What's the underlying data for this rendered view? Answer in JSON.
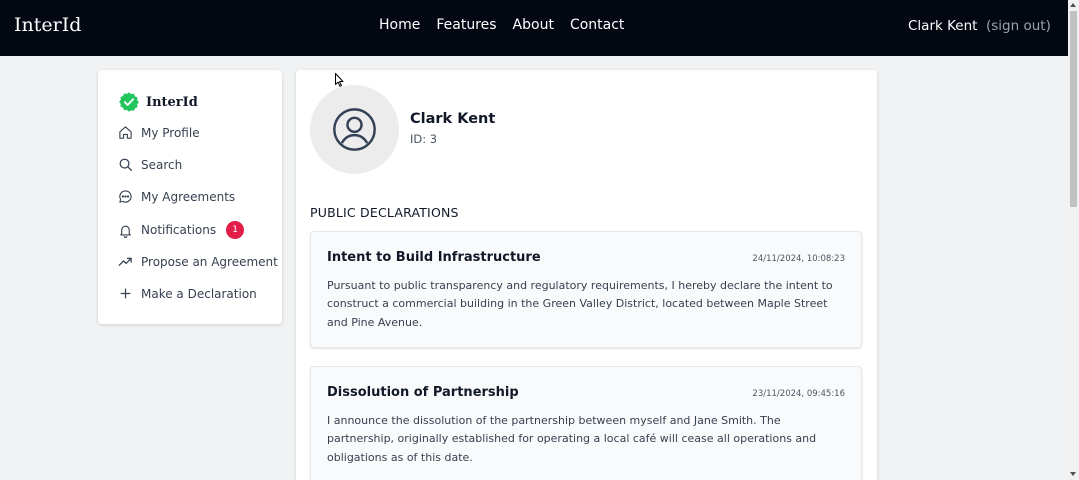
{
  "header": {
    "brand": "InterId",
    "nav": [
      "Home",
      "Features",
      "About",
      "Contact"
    ],
    "user_name": "Clark Kent",
    "sign_out": "(sign out)"
  },
  "sidebar": {
    "brand": "InterId",
    "items": [
      {
        "label": "My Profile",
        "icon": "home-icon"
      },
      {
        "label": "Search",
        "icon": "search-icon"
      },
      {
        "label": "My Agreements",
        "icon": "chat-icon"
      },
      {
        "label": "Notifications",
        "icon": "bell-icon",
        "badge": "1"
      },
      {
        "label": "Propose an Agreement",
        "icon": "trending-up-icon"
      },
      {
        "label": "Make a Declaration",
        "icon": "plus-icon"
      }
    ]
  },
  "profile": {
    "name": "Clark Kent",
    "id_text": "ID: 3"
  },
  "declarations": {
    "section_title": "PUBLIC DECLARATIONS",
    "items": [
      {
        "title": "Intent to Build Infrastructure",
        "date": "24/11/2024, 10:08:23",
        "body": "Pursuant to public transparency and regulatory requirements, I hereby declare the intent to construct a commercial building in the Green Valley District, located between Maple Street and Pine Avenue."
      },
      {
        "title": "Dissolution of Partnership",
        "date": "23/11/2024, 09:45:16",
        "body": "I announce the dissolution of the partnership between myself and Jane Smith. The partnership, originally established for operating a local café will cease all operations and obligations as of this date."
      }
    ]
  },
  "colors": {
    "topbar": "#030712",
    "verified_badge": "#22c55e",
    "notification_badge": "#e11d48",
    "avatar_icon": "#334155"
  }
}
